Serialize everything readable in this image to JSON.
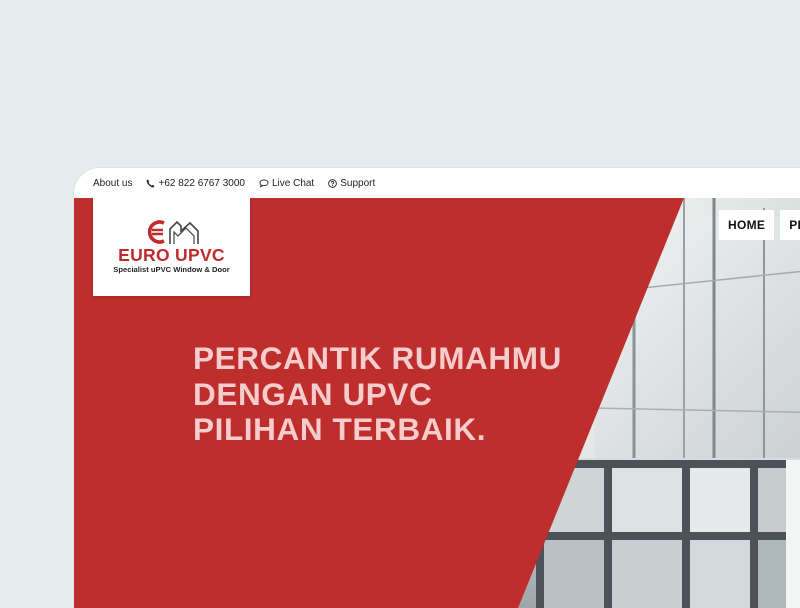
{
  "topbar": {
    "about_label": "About us",
    "phone_label": "+62 822 6767 3000",
    "chat_label": "Live Chat",
    "support_label": "Support"
  },
  "logo": {
    "name": "EURO UPVC",
    "tagline": "Specialist uPVC Window & Door"
  },
  "nav": {
    "items": [
      "HOME",
      "PRO"
    ]
  },
  "hero": {
    "headline": [
      "PERCANTIK RUMAHMU",
      "DENGAN UPVC",
      "PILIHAN TERBAIK."
    ]
  },
  "colors": {
    "brand_red": "#bd2e2d",
    "headline_pink": "#f6cccc",
    "page_bg": "#e5eded"
  },
  "icons": [
    "phone-icon",
    "chat-icon",
    "help-circle-icon",
    "euro-upvc-logo-mark"
  ]
}
